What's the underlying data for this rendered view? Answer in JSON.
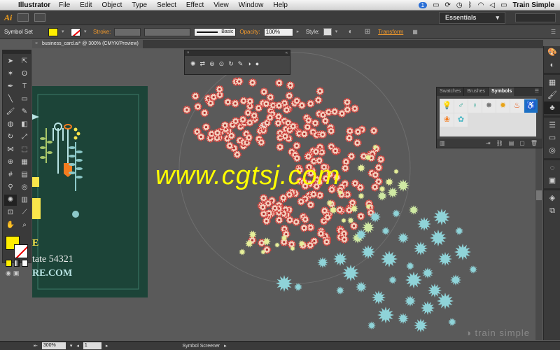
{
  "menubar": {
    "app_name": "Illustrator",
    "menus": [
      "File",
      "Edit",
      "Object",
      "Type",
      "Select",
      "Effect",
      "View",
      "Window",
      "Help"
    ],
    "notification_count": "1",
    "user": "Train Simple"
  },
  "appbar": {
    "logo": "Ai",
    "workspace": "Essentials"
  },
  "control": {
    "selection_type": "Symbol Set",
    "stroke_label": "Stroke:",
    "stroke_style": "Basic",
    "opacity_label": "Opacity:",
    "opacity_value": "100%",
    "style_label": "Style:",
    "transform_label": "Transform",
    "colors": {
      "fill": "#ffee00",
      "accent": "#f39a2b"
    }
  },
  "document": {
    "tab_title": "business_card.ai* @ 300% (CMYK/Preview)",
    "artboard_lines": [
      "E",
      "tate 54321",
      "RE.COM"
    ]
  },
  "panel": {
    "tabs": [
      "Swatches",
      "Brushes",
      "Symbols"
    ],
    "active_tab": "Symbols"
  },
  "status": {
    "zoom": "300%",
    "page": "1",
    "tool_label": "Symbol Screener"
  },
  "watermark": "www.cgtsj.com",
  "brand_logo": "train simple"
}
